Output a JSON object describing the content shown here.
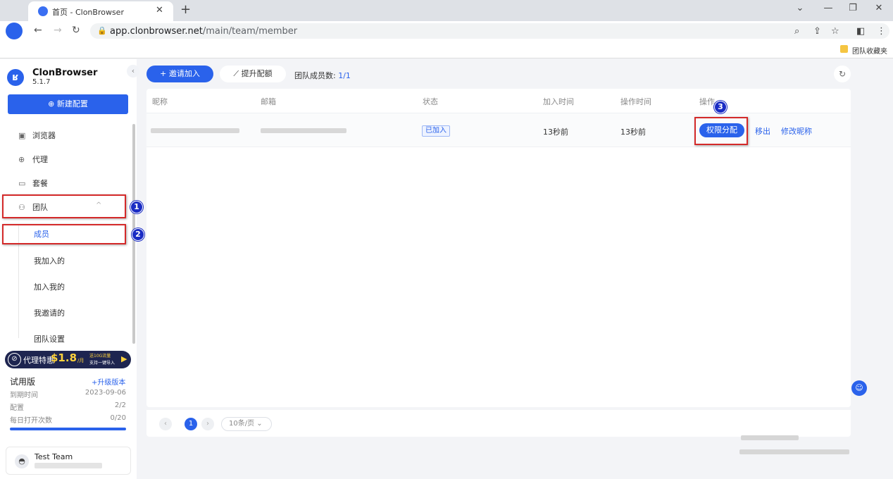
{
  "browser": {
    "tab_title": "首页 - ClonBrowser",
    "new_tab": "+",
    "url_host": "app.clonbrowser.net",
    "url_path": "/main/team/member",
    "bookmark": "团队收藏夹"
  },
  "sidebar": {
    "brand": "ClonBrowser",
    "version": "5.1.7",
    "new_config": "新建配置",
    "nav": [
      {
        "label": "浏览器",
        "icon": "browser-icon"
      },
      {
        "label": "代理",
        "icon": "globe-icon"
      },
      {
        "label": "套餐",
        "icon": "wallet-icon"
      },
      {
        "label": "团队",
        "icon": "team-icon"
      }
    ],
    "sub_items": [
      "成员",
      "我加入的",
      "加入我的",
      "我邀请的",
      "团队设置"
    ],
    "promo": {
      "label": "代理特惠",
      "price": "$1.8",
      "unit": "/月",
      "line1": "送10G流量",
      "line2": "支持一键导入"
    },
    "plan": {
      "name": "试用版",
      "upgrade": "+升级版本",
      "rows": [
        {
          "k": "到期时间",
          "v": "2023-09-06"
        },
        {
          "k": "配置",
          "v": "2/2"
        },
        {
          "k": "每日打开次数",
          "v": "0/20"
        }
      ]
    },
    "team": {
      "name": "Test Team"
    }
  },
  "toolbar": {
    "invite": "+ 邀请加入",
    "raise": "提升配额",
    "count_label": "团队成员数:",
    "count_value": "1/1"
  },
  "table": {
    "headers": [
      "昵称",
      "邮箱",
      "状态",
      "加入时间",
      "操作时间",
      "操作"
    ],
    "rows": [
      {
        "status": "已加入",
        "join_time": "13秒前",
        "op_time": "13秒前",
        "actions": [
          "权限分配",
          "移出",
          "修改昵称"
        ]
      }
    ]
  },
  "pagination": {
    "current": "1",
    "page_size": "10条/页"
  },
  "annotations": [
    "1",
    "2",
    "3"
  ],
  "colors": {
    "accent": "#2a62eb",
    "highlight_border": "#d42a2a",
    "badge": "#1a2cc4"
  }
}
